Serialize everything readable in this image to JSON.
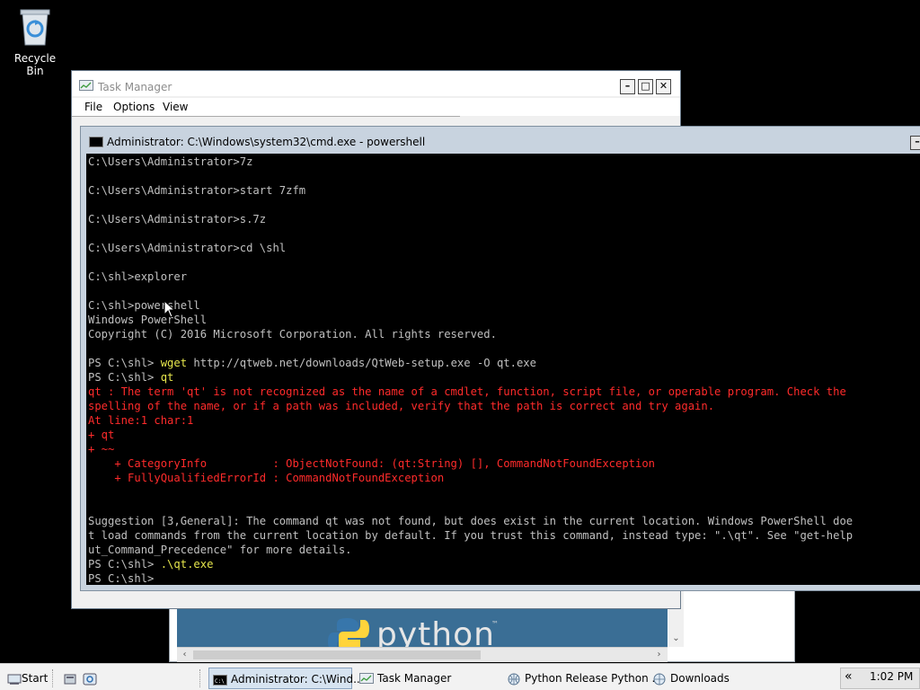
{
  "desktop": {
    "recycle_bin_label": "Recycle Bin"
  },
  "browser": {
    "banner_text": "python",
    "trademark": "™"
  },
  "taskmgr": {
    "title": "Task Manager",
    "menu": [
      "File",
      "Options",
      "View"
    ]
  },
  "console": {
    "title": "Administrator: C:\\Windows\\system32\\cmd.exe - powershell",
    "lines": [
      {
        "text": "C:\\Users\\Administrator>7z",
        "color": "gray"
      },
      {
        "text": "",
        "color": "gray"
      },
      {
        "text": "C:\\Users\\Administrator>start 7zfm",
        "color": "gray"
      },
      {
        "text": "",
        "color": "gray"
      },
      {
        "text": "C:\\Users\\Administrator>s.7z",
        "color": "gray"
      },
      {
        "text": "",
        "color": "gray"
      },
      {
        "text": "C:\\Users\\Administrator>cd \\shl",
        "color": "gray"
      },
      {
        "text": "",
        "color": "gray"
      },
      {
        "text": "C:\\shl>explorer",
        "color": "gray"
      },
      {
        "text": "",
        "color": "gray"
      },
      {
        "text": "C:\\shl>powershell",
        "color": "gray"
      },
      {
        "text": "Windows PowerShell",
        "color": "gray"
      },
      {
        "text": "Copyright (C) 2016 Microsoft Corporation. All rights reserved.",
        "color": "gray"
      },
      {
        "text": "",
        "color": "gray"
      },
      {
        "segments": [
          {
            "text": "PS C:\\shl> ",
            "color": "gray"
          },
          {
            "text": "wget",
            "color": "yellow"
          },
          {
            "text": " http://qtweb.net/downloads/QtWeb-setup.exe -O qt.exe",
            "color": "gray"
          }
        ]
      },
      {
        "segments": [
          {
            "text": "PS C:\\shl> ",
            "color": "gray"
          },
          {
            "text": "qt",
            "color": "yellow"
          }
        ]
      },
      {
        "text": "qt : The term 'qt' is not recognized as the name of a cmdlet, function, script file, or operable program. Check the",
        "color": "red"
      },
      {
        "text": "spelling of the name, or if a path was included, verify that the path is correct and try again.",
        "color": "red"
      },
      {
        "text": "At line:1 char:1",
        "color": "red"
      },
      {
        "text": "+ qt",
        "color": "red"
      },
      {
        "text": "+ ~~",
        "color": "red"
      },
      {
        "text": "    + CategoryInfo          : ObjectNotFound: (qt:String) [], CommandNotFoundException",
        "color": "red"
      },
      {
        "text": "    + FullyQualifiedErrorId : CommandNotFoundException",
        "color": "red"
      },
      {
        "text": "",
        "color": "gray"
      },
      {
        "text": "",
        "color": "gray"
      },
      {
        "text": "Suggestion [3,General]: The command qt was not found, but does exist in the current location. Windows PowerShell doe",
        "color": "gray"
      },
      {
        "text": "t load commands from the current location by default. If you trust this command, instead type: \".\\qt\". See \"get-help",
        "color": "gray"
      },
      {
        "text": "ut_Command_Precedence\" for more details.",
        "color": "gray"
      },
      {
        "segments": [
          {
            "text": "PS C:\\shl> ",
            "color": "gray"
          },
          {
            "text": ".\\qt.exe",
            "color": "yellow"
          }
        ]
      },
      {
        "text": "PS C:\\shl> ",
        "color": "gray"
      }
    ]
  },
  "taskbar": {
    "start_label": "Start",
    "items": [
      {
        "label": "Administrator: C:\\Wind...",
        "active": true
      },
      {
        "label": "Task Manager",
        "active": false
      },
      {
        "label": "Python Release Python ...",
        "active": false
      },
      {
        "label": "Downloads",
        "active": false
      }
    ],
    "tray_chevron": "«",
    "clock": "1:02 PM"
  },
  "colors": {
    "console_bg": "#000000",
    "console_text": "#c0c0c0",
    "error_text": "#ff2b2b",
    "command_text": "#e6e64c",
    "titlebar": "#c8d3df",
    "python_banner": "#3a6e95"
  }
}
